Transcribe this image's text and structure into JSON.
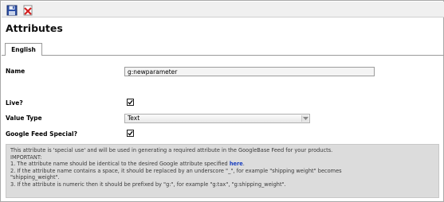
{
  "toolbar": {
    "save_icon": "save-disk-icon",
    "cancel_icon": "cancel-icon"
  },
  "page": {
    "title": "Attributes"
  },
  "tabs": [
    {
      "label": "English"
    }
  ],
  "form": {
    "name_label": "Name",
    "name_value": "g:newparameter",
    "live_label": "Live?",
    "live_checked": true,
    "value_type_label": "Value Type",
    "value_type_selected": "Text",
    "google_feed_label": "Google Feed Special?",
    "google_feed_checked": true
  },
  "note": {
    "line1": "This attribute is 'special use' and will be used in generating a required attribute in the GoogleBase Feed for your products.",
    "line2": "IMPORTANT:",
    "line3_prefix": "1. The attribute name should be identical to the desired Google attribute specified ",
    "line3_link": "here",
    "line3_suffix": ".",
    "line4": "2. If the attribute name contains a space, it should be replaced by an underscore \"_\", for example \"shipping weight\" becomes",
    "line5": "\"shipping_weight\".",
    "line6": "3. If the attribute is numeric then it should be prefixed by \"g:\", for example \"g:tax\", \"g:shipping_weight\"."
  },
  "colors": {
    "link": "#1a3fbf",
    "note_bg": "#dcdcdc",
    "toolbar_bg": "#f0f0f0"
  }
}
